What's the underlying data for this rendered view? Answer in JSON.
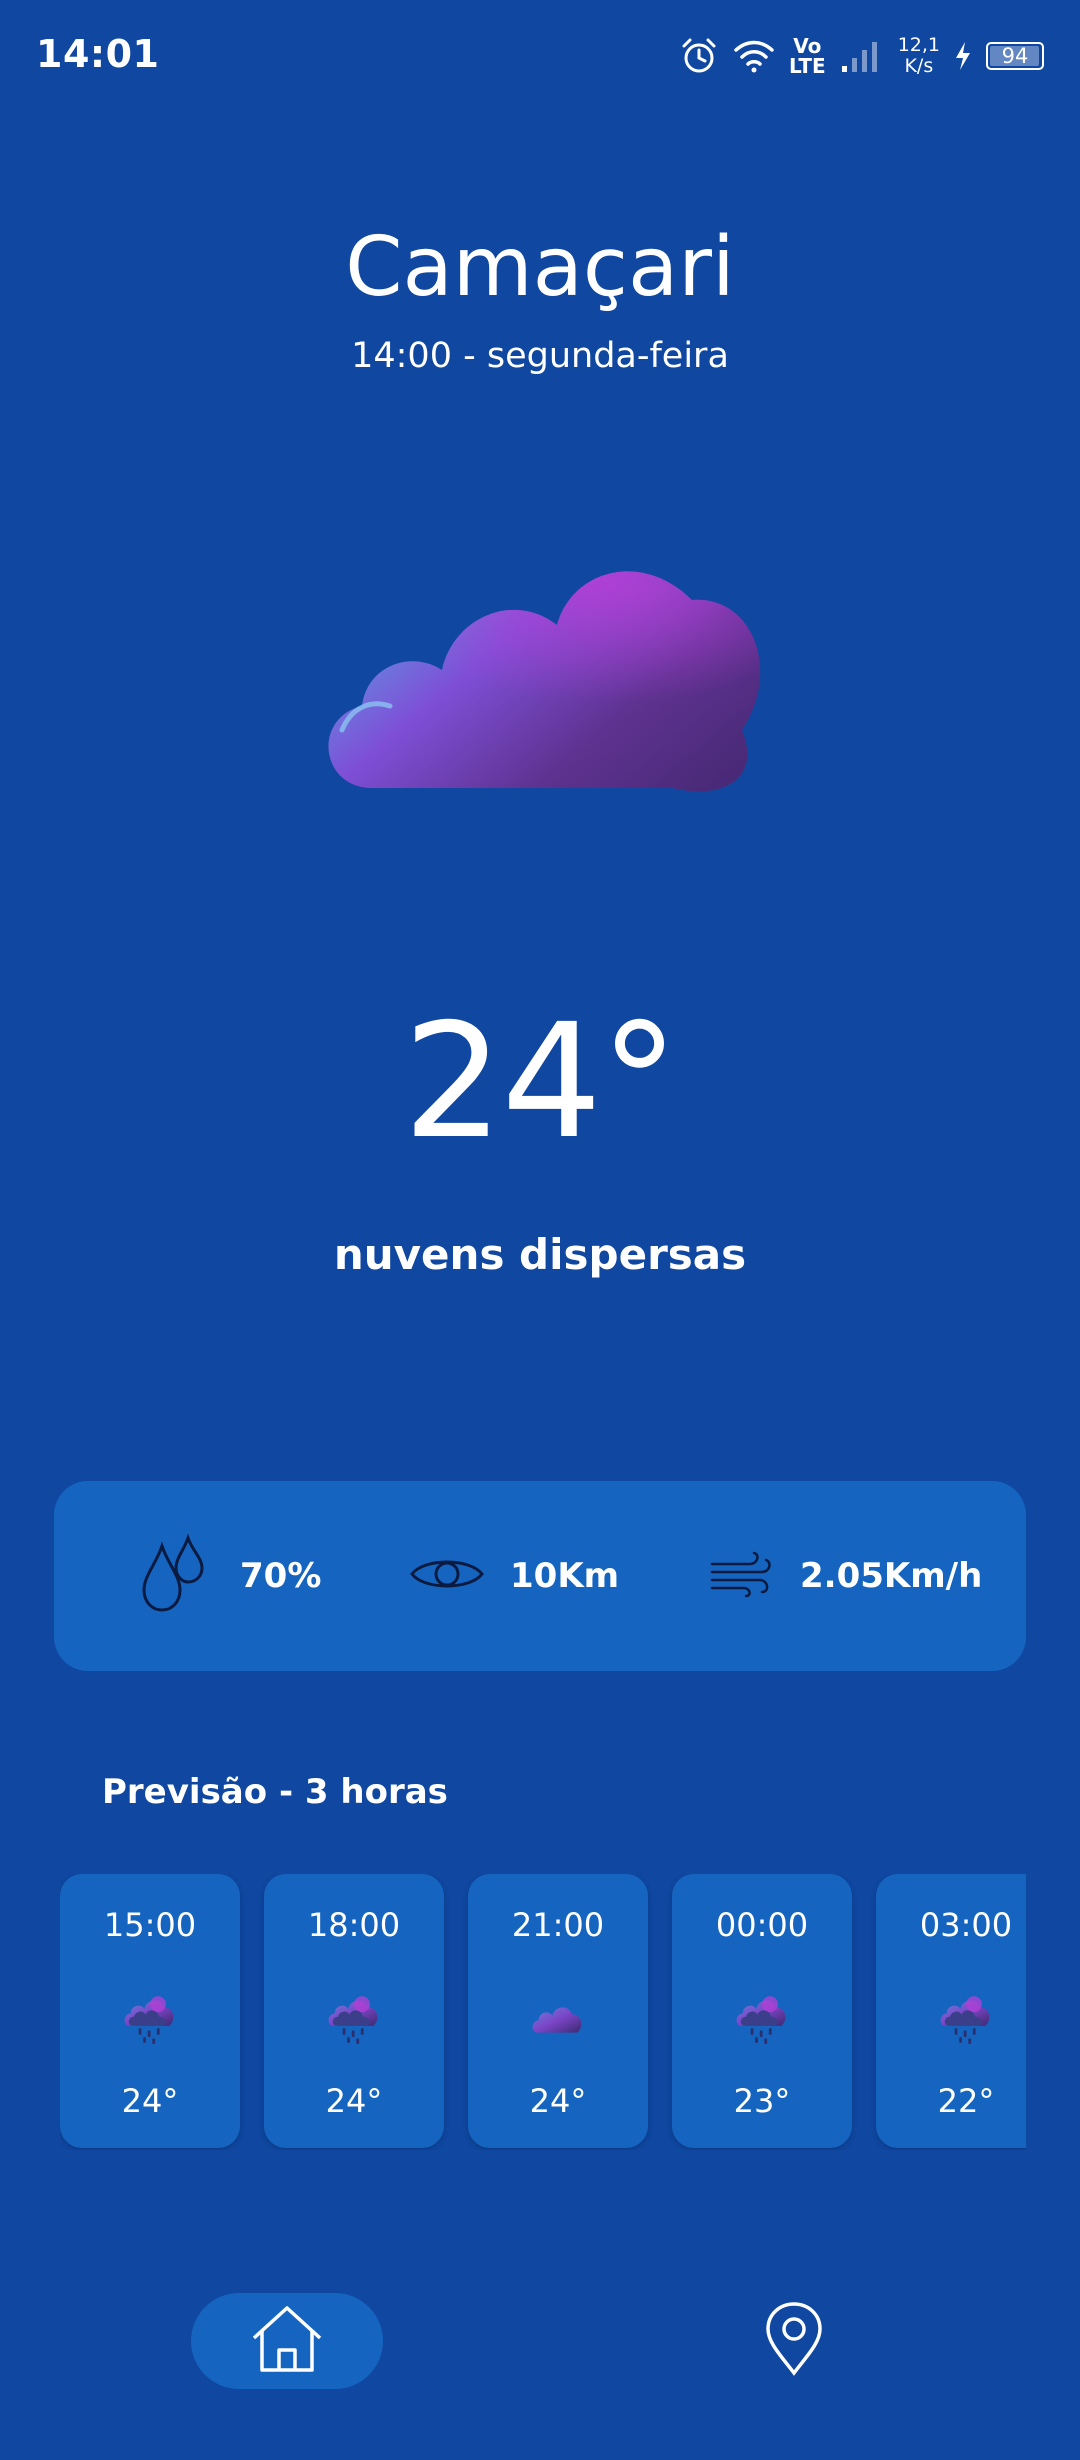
{
  "status_bar": {
    "time": "14:01",
    "volte_top": "Vo",
    "volte_bottom": "LTE",
    "net_speed_value": "12,1",
    "net_speed_unit": "K/s",
    "battery_level": "94",
    "icons": [
      "alarm-icon",
      "wifi-icon",
      "volte-icon",
      "signal-icon",
      "charging-icon",
      "battery-icon"
    ]
  },
  "location": {
    "city": "Camaçari",
    "datetime": "14:00 - segunda-feira"
  },
  "current": {
    "temperature": "24°",
    "description": "nuvens dispersas",
    "icon": "scattered-clouds-icon"
  },
  "stats": {
    "humidity": {
      "icon": "humidity-drops-icon",
      "value": "70%"
    },
    "visibility": {
      "icon": "eye-icon",
      "value": "10Km"
    },
    "wind": {
      "icon": "wind-icon",
      "value": "2.05Km/h"
    }
  },
  "forecast": {
    "title": "Previsão - 3 horas",
    "items": [
      {
        "time": "15:00",
        "temp": "24°",
        "icon": "rain-cloud-icon"
      },
      {
        "time": "18:00",
        "temp": "24°",
        "icon": "rain-cloud-icon"
      },
      {
        "time": "21:00",
        "temp": "24°",
        "icon": "cloud-icon"
      },
      {
        "time": "00:00",
        "temp": "23°",
        "icon": "rain-cloud-icon"
      },
      {
        "time": "03:00",
        "temp": "22°",
        "icon": "rain-cloud-icon"
      }
    ]
  },
  "nav": {
    "items": [
      {
        "id": "home",
        "icon": "home-icon",
        "active": true
      },
      {
        "id": "location",
        "icon": "location-pin-icon",
        "active": false
      }
    ]
  },
  "colors": {
    "background": "#0f47a1",
    "card": "#1565c0",
    "text": "#ffffff"
  }
}
